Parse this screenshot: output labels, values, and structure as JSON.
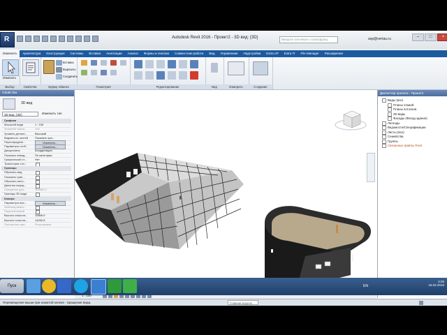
{
  "window": {
    "title": "Autodesk Revit 2016 -",
    "project": "Проект2 - 3D вид: {3D}",
    "search_placeholder": "Введите ключевое слово/фразу",
    "user": "avp@vertau.ru"
  },
  "app_button_label": "R",
  "tabs": [
    "Изменить",
    "Архитектура",
    "Конструкция",
    "Системы",
    "Вставка",
    "Аннотации",
    "Анализ",
    "Формы и генплан",
    "Совместная работа",
    "Вид",
    "Управление",
    "Надстройки",
    "Extra AP",
    "Extra Tr",
    "File Manager",
    "Расширения"
  ],
  "ribbon": {
    "modify_label": "Изменить",
    "groups": [
      "Выбор",
      "Свойства",
      "Буфер обмена",
      "Геометрия",
      "Редактирование",
      "Вид",
      "Измерить",
      "Создание"
    ],
    "clipboard": [
      "Вставка",
      "Вырезать",
      "Соединить"
    ]
  },
  "properties": {
    "title": "Свойства",
    "type_name": "3D вид",
    "selector": "3D вид: {3D}",
    "edit_type": "Изменить тип",
    "rows": [
      {
        "type": "section",
        "k": "Графика"
      },
      {
        "k": "Масштаб вида",
        "v": "1 : 100"
      },
      {
        "k": "Значение масш...",
        "v": "100",
        "grey": true
      },
      {
        "k": "Уровень детали...",
        "v": "Высокий"
      },
      {
        "k": "Видимость частей",
        "v": "Показать ори..."
      },
      {
        "k": "Переопределе...",
        "v": "Изменить...",
        "button": true
      },
      {
        "k": "Параметры отоб...",
        "v": "Изменить...",
        "button": true
      },
      {
        "k": "Дисциплина",
        "v": "Координация"
      },
      {
        "k": "Показать невид...",
        "v": "По категории"
      },
      {
        "k": "Графический ст...",
        "v": "Нет"
      },
      {
        "k": "Траектория сол...",
        "check": true
      },
      {
        "type": "section",
        "k": "Границы"
      },
      {
        "k": "Обрезать вид",
        "check": true
      },
      {
        "k": "Показать гран...",
        "check": true
      },
      {
        "k": "Обрезать анно...",
        "check": true
      },
      {
        "k": "Дальняя секущ...",
        "check": true
      },
      {
        "k": "Смещение дал...",
        "v": "304800.0",
        "grey": true
      },
      {
        "k": "Границы 3D вида",
        "check": true
      },
      {
        "type": "section",
        "k": "Камера"
      },
      {
        "k": "Параметры виз...",
        "v": "Изменить...",
        "button": true
      },
      {
        "k": "Заблокировано...",
        "check": true,
        "grey": true
      },
      {
        "k": "Перспективный",
        "check": true,
        "grey": true
      },
      {
        "k": "Высота глаза на...",
        "v": "10806.9"
      },
      {
        "k": "Высота точки на...",
        "v": "14292.8"
      },
      {
        "k": "Положение кам...",
        "v": "Регулировка",
        "grey": true
      }
    ],
    "help_link": "Справка по свойствам",
    "apply": "Применить"
  },
  "view": {
    "scale": "1 : 100",
    "model_combo": "Главная модель"
  },
  "browser": {
    "title": "Диспетчер проекта - Проект2",
    "items": [
      {
        "label": "Виды (все)",
        "level": 0,
        "expanded": true
      },
      {
        "label": "Планы этажей",
        "level": 1
      },
      {
        "label": "Планы потолков",
        "level": 1
      },
      {
        "label": "3D виды",
        "level": 1
      },
      {
        "label": "Фасады (Фасад здания)",
        "level": 1
      },
      {
        "label": "Легенды",
        "level": 0
      },
      {
        "label": "Ведомости/Спецификации",
        "level": 0
      },
      {
        "label": "Листы (все)",
        "level": 0
      },
      {
        "label": "Семейства",
        "level": 0
      },
      {
        "label": "Группы",
        "level": 0
      },
      {
        "label": "Связанные файлы Revit",
        "level": 0,
        "highlight": true
      }
    ]
  },
  "status": {
    "hint": "Перемещение мыши при нажатой кнопке - вращение вида."
  },
  "taskbar": {
    "start": "Пуск",
    "lang": "EN",
    "time": "2:25",
    "date": "16.02.2016"
  },
  "colors": {
    "ribbon_tabs": "#1c5aa0",
    "panel_title": "#4c6e9e",
    "taskbar": "#1f3f6a",
    "curtain_panel": "#d6d6d6",
    "wall_dark": "#2a2a2a"
  }
}
